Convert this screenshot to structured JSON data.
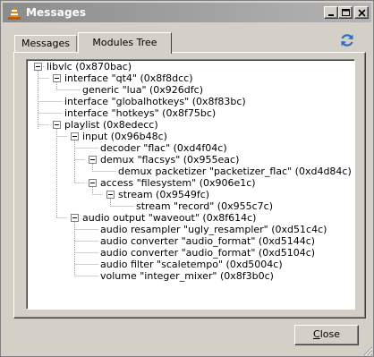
{
  "window": {
    "title": "Messages",
    "controls": {
      "minimize": "minimize-icon",
      "maximize": "maximize-icon",
      "close": "close-icon"
    }
  },
  "tabs": [
    {
      "label": "Messages",
      "active": false
    },
    {
      "label": "Modules Tree",
      "active": true
    }
  ],
  "refresh_icon": "refresh-icon",
  "tree": [
    {
      "label": "libvlc (0x870bac)",
      "expanded": true
    },
    {
      "label": "interface \"qt4\" (0x8f8dcc)",
      "expanded": true
    },
    {
      "label": "generic \"lua\" (0x926dfc)"
    },
    {
      "label": "interface \"globalhotkeys\" (0x8f83bc)"
    },
    {
      "label": "interface \"hotkeys\" (0x8f75bc)"
    },
    {
      "label": "playlist (0x8edecc)",
      "expanded": true
    },
    {
      "label": "input (0x96b48c)",
      "expanded": true
    },
    {
      "label": "decoder \"flac\" (0xd4f04c)"
    },
    {
      "label": "demux \"flacsys\" (0x955eac)",
      "expanded": true
    },
    {
      "label": "demux packetizer \"packetizer_flac\" (0xd4d84c)"
    },
    {
      "label": "access \"filesystem\" (0x906e1c)",
      "expanded": true
    },
    {
      "label": "stream (0x9549fc)",
      "expanded": true
    },
    {
      "label": "stream \"record\" (0x955c7c)"
    },
    {
      "label": "audio output \"waveout\" (0x8f614c)",
      "expanded": true
    },
    {
      "label": "audio resampler \"ugly_resampler\" (0xd51c4c)"
    },
    {
      "label": "audio converter \"audio_format\" (0xd5144c)"
    },
    {
      "label": "audio converter \"audio_format\" (0xd5104c)"
    },
    {
      "label": "audio filter \"scaletempo\" (0xd5004c)"
    },
    {
      "label": "volume \"integer_mixer\" (0x8f3b0c)"
    }
  ],
  "footer": {
    "close_prefix": "",
    "close_mnemonic": "C",
    "close_rest": "lose"
  }
}
